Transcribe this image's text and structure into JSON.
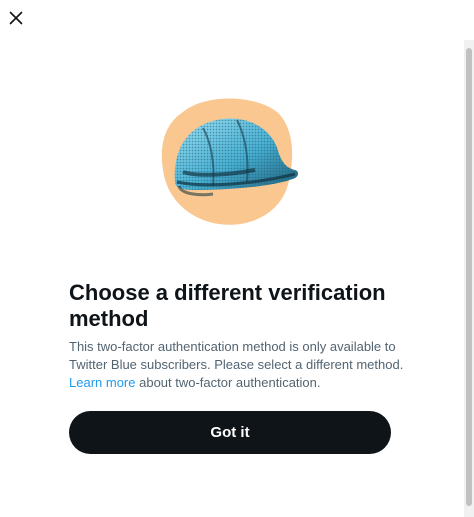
{
  "dialog": {
    "title": "Choose a different verification method",
    "body_text": "This two-factor authentication method is only available to Twitter Blue subscribers. Please select a different method.",
    "learn_more_link": "Learn more",
    "body_suffix": "about two-factor authentication.",
    "primary_button": "Got it",
    "illustration_icon": "hard-hat-icon"
  },
  "colors": {
    "text_primary": "#0f1419",
    "text_secondary": "#536471",
    "link": "#1d9bf0",
    "button_bg": "#0f1419",
    "button_text": "#ffffff",
    "illustration_blob": "#f9c78f",
    "illustration_helmet": "#4fb6d8"
  },
  "icons": {
    "close": "close-icon"
  }
}
